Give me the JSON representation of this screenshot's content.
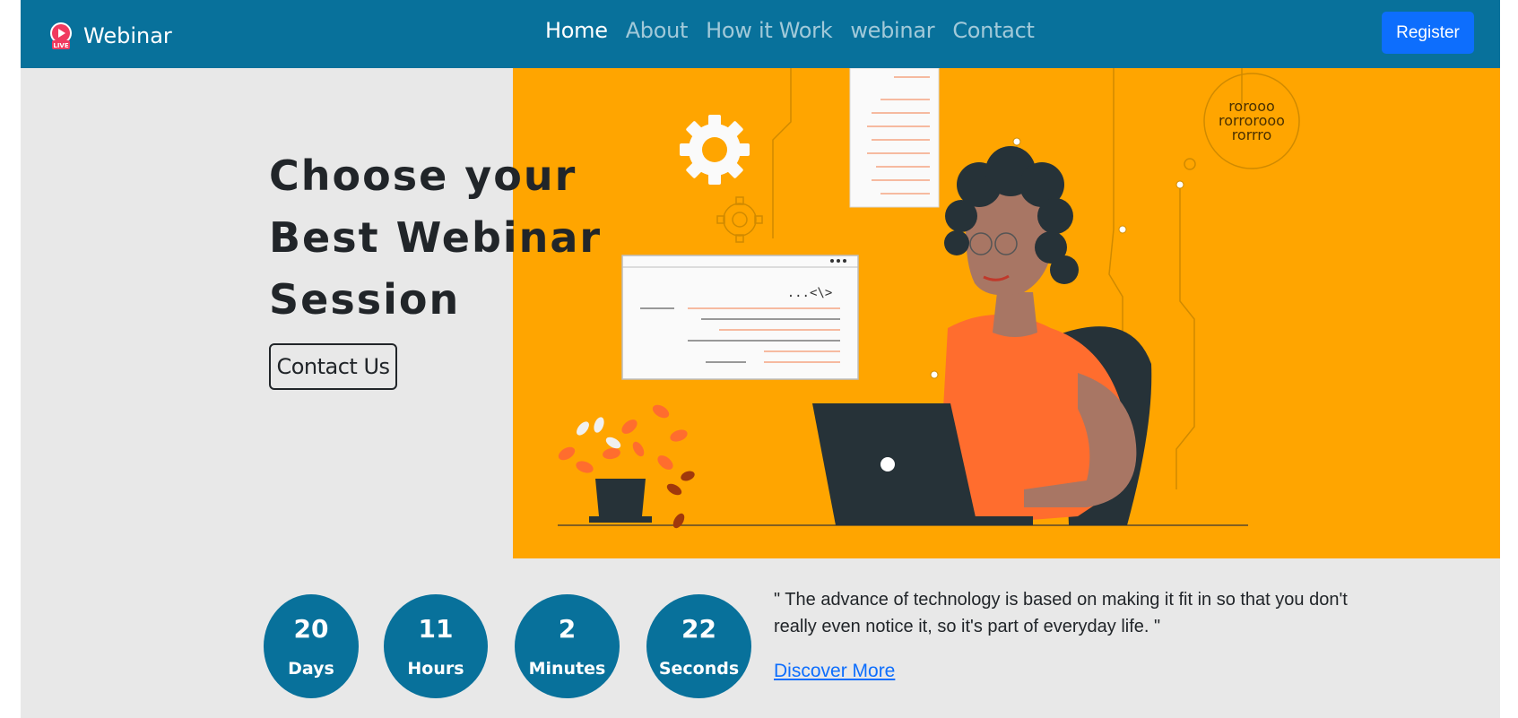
{
  "navbar": {
    "brand": "Webinar",
    "brand_icon": "live-play-icon",
    "links": [
      {
        "label": "Home",
        "active": true
      },
      {
        "label": "About",
        "active": false
      },
      {
        "label": "How it Work",
        "active": false
      },
      {
        "label": "webinar",
        "active": false
      },
      {
        "label": "Contact",
        "active": false
      }
    ],
    "register_label": "Register"
  },
  "hero": {
    "title_lines": [
      "Choose your",
      "Best Webinar",
      "Session"
    ],
    "contact_label": "Contact Us",
    "illustration_code_tag": "...<\\>",
    "illustration_binary": [
      "rorooo",
      "rorrorooo",
      "rorrro"
    ]
  },
  "countdown": [
    {
      "value": "20",
      "label": "Days"
    },
    {
      "value": "11",
      "label": "Hours"
    },
    {
      "value": "2",
      "label": "Minutes"
    },
    {
      "value": "22",
      "label": "Seconds"
    }
  ],
  "quote": {
    "text": "\" The advance of technology is based on making it fit in so that you don't really even notice it, so it's part of everyday life. \"",
    "link_label": "Discover More"
  },
  "colors": {
    "navbar": "#08719b",
    "accent": "#0d6efd",
    "hero_bg": "#ffa500",
    "page_bg": "#e8e8e8",
    "countdown": "#08719b"
  }
}
